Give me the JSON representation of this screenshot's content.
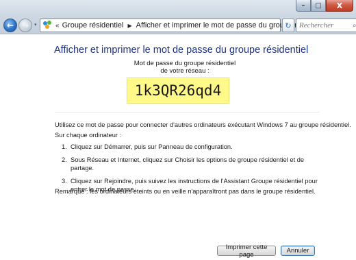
{
  "window": {
    "controls": {
      "minimize": "–",
      "maximize": "□",
      "close": "X"
    }
  },
  "nav": {
    "back_glyph": "←",
    "forward_glyph": "→",
    "history_glyph": "▾"
  },
  "address": {
    "overflow": "«",
    "crumbs": [
      "Groupe résidentiel",
      "Afficher et imprimer le mot de passe du groupe résidentiel"
    ],
    "separator": "▶",
    "dropdown_glyph": "▾",
    "refresh_glyph": "↻"
  },
  "search": {
    "placeholder": "Rechercher",
    "icon_glyph": "⌕"
  },
  "page": {
    "title": "Afficher et imprimer le mot de passe du groupe résidentiel",
    "caption_line1": "Mot de passe du groupe résidentiel",
    "caption_line2": "de votre réseau :",
    "password": "1k3QR26qd4",
    "intro": "Utilisez ce mot de passe pour connecter d'autres ordinateurs exécutant Windows 7 au groupe résidentiel.",
    "each_computer": "Sur chaque ordinateur :",
    "steps": [
      {
        "num": "1.",
        "text": "Cliquez sur Démarrer, puis sur Panneau de configuration."
      },
      {
        "num": "2.",
        "text": "Sous Réseau et Internet, cliquez sur Choisir les options de groupe résidentiel et de partage."
      },
      {
        "num": "3.",
        "text": "Cliquez sur Rejoindre, puis suivez les instructions de l'Assistant Groupe résidentiel pour entrer le mot de passe."
      }
    ],
    "note": "Remarque : les ordinateurs éteints ou en veille n'apparaîtront pas dans le groupe résidentiel."
  },
  "buttons": {
    "print": "Imprimer cette page",
    "cancel": "Annuler"
  },
  "colors": {
    "title": "#1e3287",
    "password_bg": "#fff98a"
  },
  "icons": {
    "homegroup": "homegroup-icon",
    "back": "back-arrow-icon",
    "forward": "forward-arrow-icon",
    "refresh": "refresh-icon",
    "search": "search-icon"
  }
}
